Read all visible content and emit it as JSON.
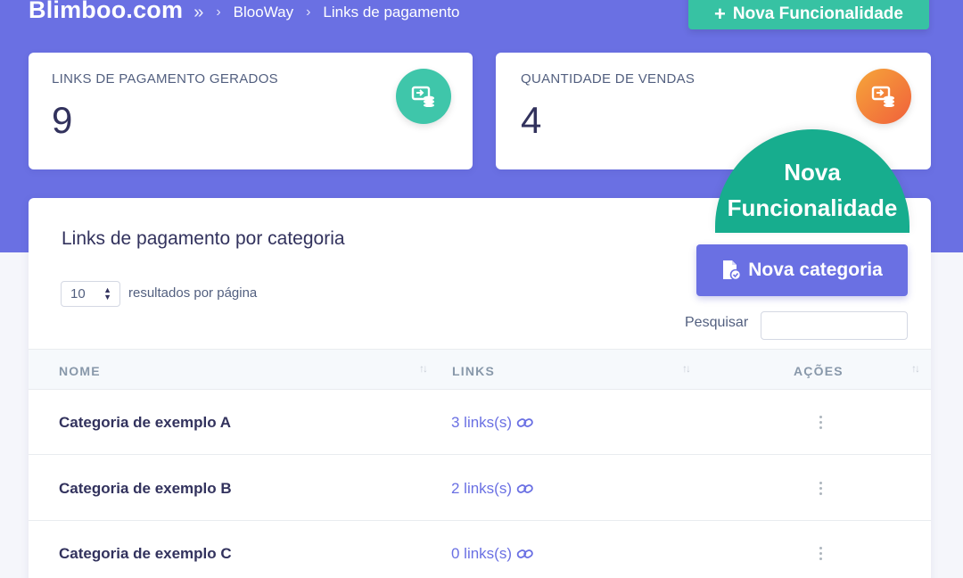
{
  "header": {
    "brand": "Blimboo.com",
    "breadcrumb_sep": "»",
    "breadcrumb_chevron": "›",
    "breadcrumbs": [
      "BlooWay",
      "Links de pagamento"
    ],
    "new_feature_button": "Nova Funcionalidade"
  },
  "stats": [
    {
      "label": "LINKS DE PAGAMENTO GERADOS",
      "value": "9",
      "icon": "payment-link-icon",
      "color": "#3fc6aa"
    },
    {
      "label": "QUANTIDADE DE VENDAS",
      "value": "4",
      "icon": "sales-icon",
      "color": "#f0603b"
    }
  ],
  "badge": {
    "line1": "Nova",
    "line2": "Funcionalidade"
  },
  "card": {
    "title": "Links de pagamento por categoria",
    "page_length": "10",
    "page_length_label": "resultados por página",
    "new_category_button": "Nova categoria",
    "search_label": "Pesquisar",
    "search_value": "",
    "columns": [
      "NOME",
      "LINKS",
      "AÇÕES"
    ],
    "rows": [
      {
        "name": "Categoria de exemplo A",
        "links": "3 links(s)"
      },
      {
        "name": "Categoria de exemplo B",
        "links": "2 links(s)"
      },
      {
        "name": "Categoria de exemplo C",
        "links": "0 links(s)"
      }
    ]
  },
  "colors": {
    "primary": "#6a70e3",
    "teal": "#37c2a3",
    "badge": "#17ad8e",
    "link": "#6a70e3"
  }
}
